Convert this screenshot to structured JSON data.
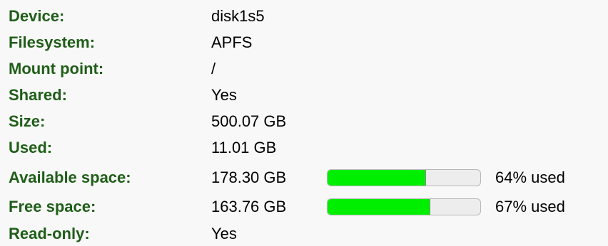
{
  "rows": [
    {
      "label": "Device:",
      "value": "disk1s5"
    },
    {
      "label": "Filesystem:",
      "value": "APFS"
    },
    {
      "label": "Mount point:",
      "value": "/"
    },
    {
      "label": "Shared:",
      "value": "Yes"
    },
    {
      "label": "Size:",
      "value": "500.07 GB"
    },
    {
      "label": "Used:",
      "value": "11.01 GB"
    },
    {
      "label": "Available space:",
      "value": "178.30 GB",
      "usage_percent": 64,
      "usage_text": "64% used"
    },
    {
      "label": "Free space:",
      "value": "163.76 GB",
      "usage_percent": 67,
      "usage_text": "67% used"
    },
    {
      "label": "Read-only:",
      "value": "Yes"
    }
  ],
  "colors": {
    "label_text": "#1f5e18",
    "usage_fill": "#00ef00",
    "usage_track": "#ededed",
    "background": "#f8f8f8"
  }
}
